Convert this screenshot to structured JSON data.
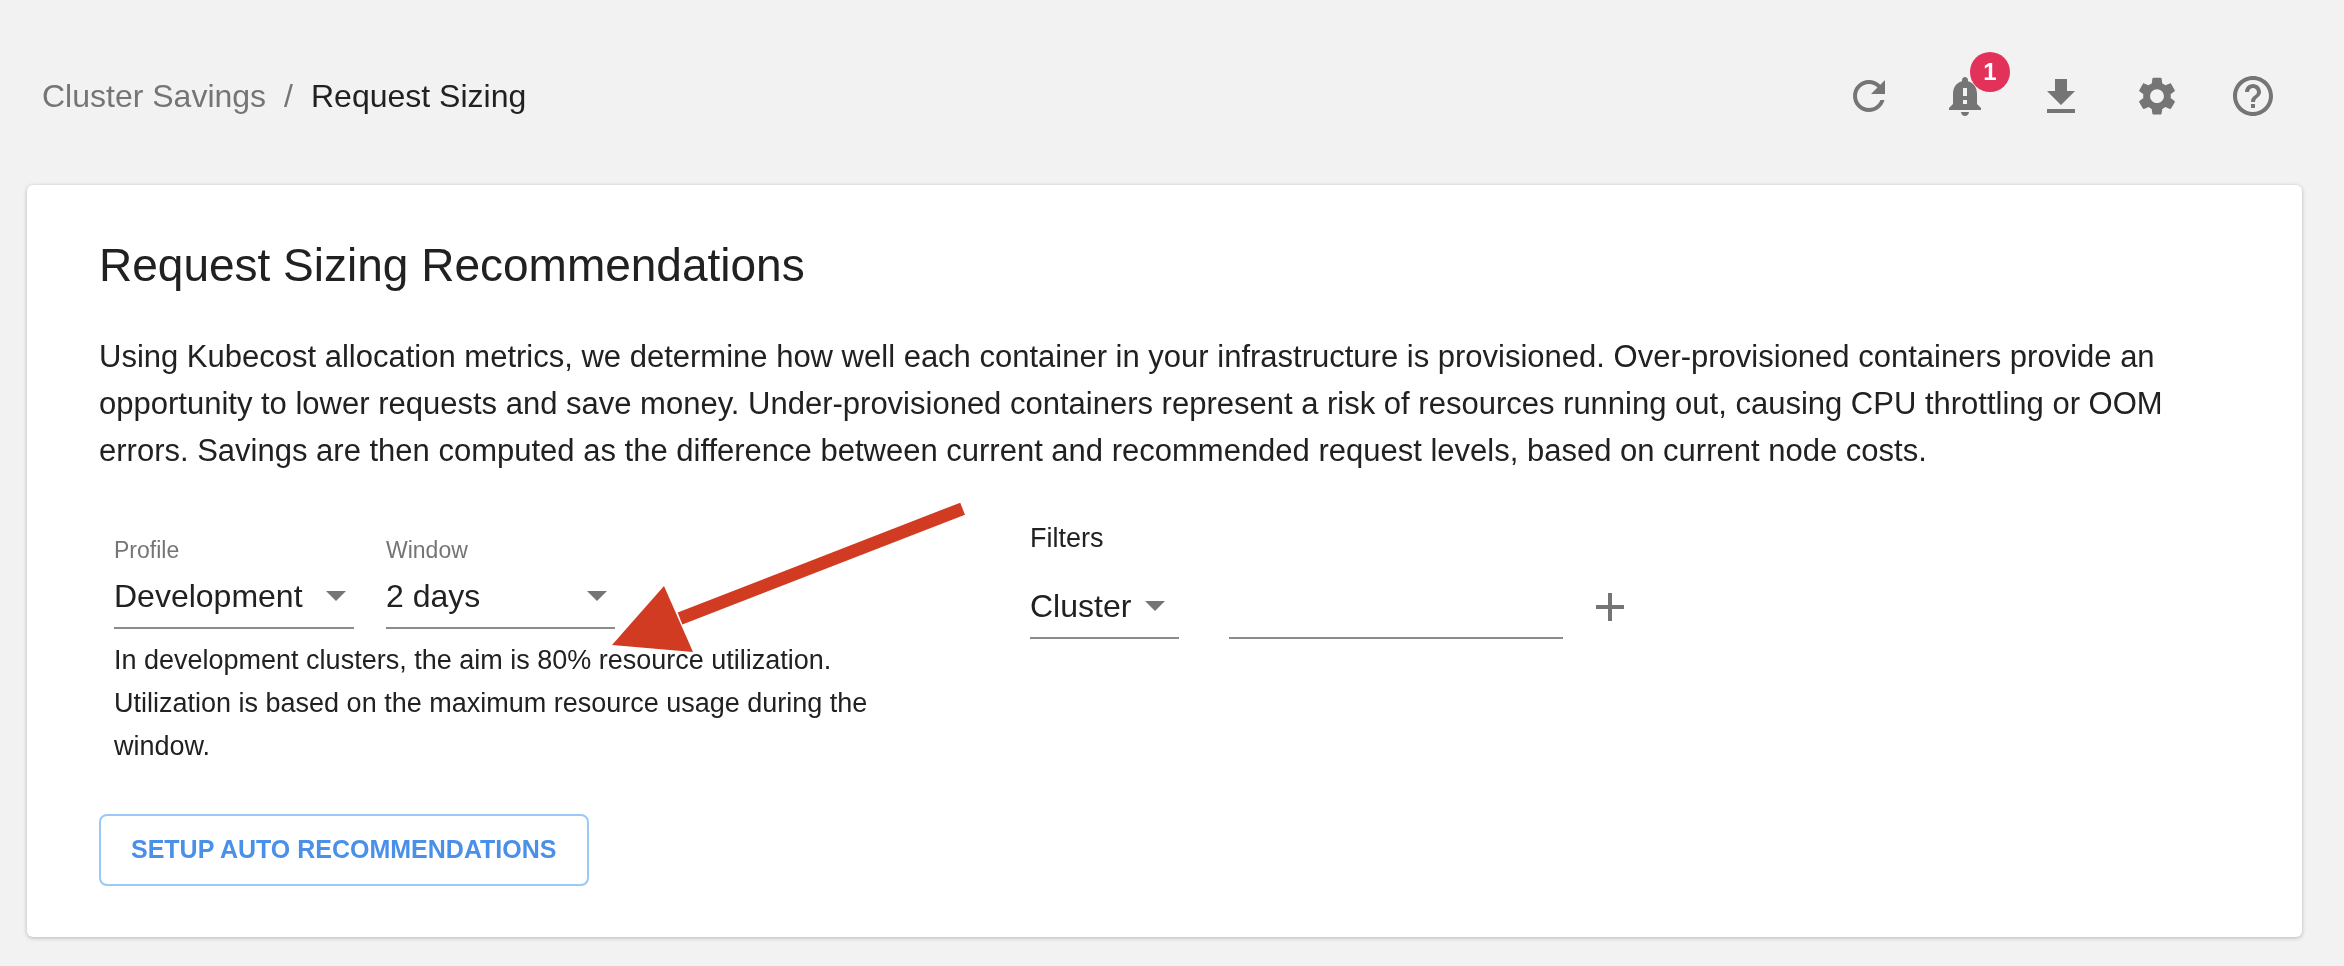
{
  "breadcrumb": {
    "items": [
      {
        "label": "Cluster Savings",
        "current": false
      },
      {
        "label": "Request Sizing",
        "current": true
      }
    ],
    "separator": "/"
  },
  "toolbar": {
    "icons": [
      {
        "kind": "refresh"
      },
      {
        "kind": "notifications",
        "badge": "1"
      },
      {
        "kind": "download"
      },
      {
        "kind": "settings"
      },
      {
        "kind": "help"
      }
    ]
  },
  "card": {
    "title": "Request Sizing Recommendations",
    "description": "Using Kubecost allocation metrics, we determine how well each container in your infrastructure is provisioned. Over-provisioned containers provide an opportunity to lower requests and save money. Under-provisioned containers represent a risk of resources running out, causing CPU throttling or OOM errors. Savings are then computed as the difference between current and recommended request levels, based on current node costs.",
    "selects": [
      {
        "label": "Profile",
        "value": "Development"
      },
      {
        "label": "Window",
        "value": "2 days"
      }
    ],
    "profile_hint": "In development clusters, the aim is 80% resource utilization. Utilization is based on the maximum resource usage during the window.",
    "button": {
      "label": "SETUP AUTO RECOMMENDATIONS"
    },
    "filters": {
      "label": "Filters",
      "property": "Cluster"
    }
  },
  "annotation": {
    "kind": "arrow"
  }
}
